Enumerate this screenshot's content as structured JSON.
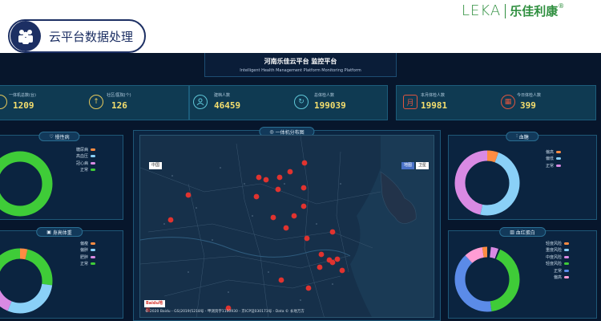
{
  "header": {
    "badge_label": "云平台数据处理",
    "logo_en": "LEKA",
    "logo_cn": "乐佳利康",
    "logo_mark": "®"
  },
  "title": {
    "cn": "河南乐佳云平台 监控平台",
    "en": "Intelligent Health Management Platform Monitoring Platform"
  },
  "stats": [
    {
      "label": "一体机总数(台)",
      "value": "1209"
    },
    {
      "label": "社区/医院(个)",
      "value": "126"
    },
    {
      "label": "建档人数",
      "value": "46459"
    },
    {
      "label": "总体检人数",
      "value": "199039"
    },
    {
      "label": "本月体检人数",
      "value": "19981"
    },
    {
      "label": "今日体检人数",
      "value": "399"
    }
  ],
  "stat_icons": [
    "person-group-icon",
    "arrow-up-circle-icon",
    "user-icon",
    "refresh-icon",
    "month-icon",
    "calendar-icon"
  ],
  "stat_icon_glyphs": [
    "",
    "↑",
    "",
    "↻",
    "月",
    "▦"
  ],
  "panels": {
    "chronic": {
      "title": "慢性病",
      "legend": [
        {
          "label": "糖尿病",
          "color": "#ff8c42"
        },
        {
          "label": "高血压",
          "color": "#8ad0f7"
        },
        {
          "label": "冠心病",
          "color": "#d98ae3"
        },
        {
          "label": "正常",
          "color": "#3fcc38"
        }
      ]
    },
    "height_weight": {
      "title": "身高体重",
      "legend": [
        {
          "label": "偏瘦",
          "color": "#ff8c42"
        },
        {
          "label": "偏胖",
          "color": "#8ad0f7"
        },
        {
          "label": "肥胖",
          "color": "#d98ae3"
        },
        {
          "label": "正常",
          "color": "#3fcc38"
        }
      ]
    },
    "blood_sugar": {
      "title": "血糖",
      "legend": [
        {
          "label": "偏高",
          "color": "#ff8c42"
        },
        {
          "label": "偏低",
          "color": "#8ad0f7"
        },
        {
          "label": "正常",
          "color": "#d98ae3"
        }
      ]
    },
    "hemoglobin": {
      "title": "血红蛋白",
      "legend": [
        {
          "label": "轻度风险",
          "color": "#ff8c42"
        },
        {
          "label": "重度风险",
          "color": "#8ad0f7"
        },
        {
          "label": "中度风险",
          "color": "#d98ae3"
        },
        {
          "label": "轻度风险",
          "color": "#3fcc38"
        },
        {
          "label": "正常",
          "color": "#5b8be8"
        },
        {
          "label": "偏高",
          "color": "#ff9dd4"
        }
      ]
    },
    "map": {
      "title": "一体机分布图",
      "tag_left": "中国",
      "tag_right_a": "地图",
      "tag_right_b": "卫星",
      "baidu": "Baidu地图",
      "copyright": "© 2020 Baidu - GS(2019)5218号 - 甲测资字1100930 - 京ICP证030173号 - Data © 长地万方"
    }
  },
  "colors": {
    "bg": "#07162c",
    "accent_value": "#f5df6e",
    "brand_navy": "#1c2f63",
    "brand_green": "#2f8f3f"
  }
}
